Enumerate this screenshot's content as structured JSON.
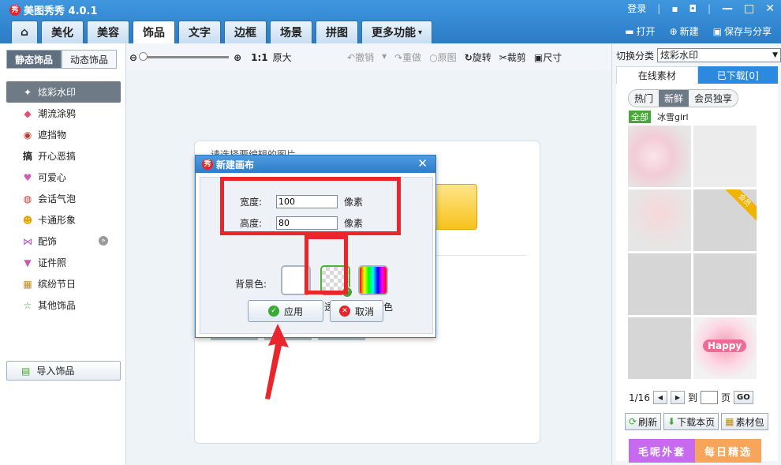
{
  "app": {
    "title": "美图秀秀 4.0.1",
    "logo_char": "秀"
  },
  "window": {
    "login": "登录",
    "sep": "|"
  },
  "main_tabs": [
    "美化",
    "美容",
    "饰品",
    "文字",
    "边框",
    "场景",
    "拼图",
    "更多功能"
  ],
  "right_actions": {
    "open": "打开",
    "new": "新建",
    "save_share": "保存与分享"
  },
  "toolbar": {
    "zoom_ratio": "1:1",
    "original_size": "原大",
    "undo": "撤销",
    "redo": "重做",
    "original": "原图",
    "rotate": "旋转",
    "crop": "裁剪",
    "size": "尺寸"
  },
  "left_panel": {
    "tabs": [
      "静态饰品",
      "动态饰品"
    ],
    "categories": [
      "炫彩水印",
      "潮流涂鸦",
      "遮挡物",
      "开心恶搞",
      "可爱心",
      "会话气泡",
      "卡通形象",
      "配饰",
      "证件照",
      "缤纷节日",
      "其他饰品"
    ],
    "import": "导入饰品"
  },
  "canvas": {
    "hint": "请选择要编辑的图片"
  },
  "dialog": {
    "title": "新建画布",
    "width_label": "宽度:",
    "width_value": "100",
    "height_label": "高度:",
    "height_value": "80",
    "unit": "像素",
    "bg_label": "背景色:",
    "swatch_white": "白色",
    "swatch_transparent": "透明",
    "swatch_custom": "自定颜色",
    "apply": "应用",
    "cancel": "取消",
    "selected_bg": "透明"
  },
  "right_panel": {
    "category_label": "切换分类",
    "category_value": "炫彩水印",
    "tabs": [
      "在线素材",
      "已下载[0]"
    ],
    "pills": [
      "热门",
      "新鲜",
      "会员独享"
    ],
    "filter_all": "全部",
    "filter_user": "冰雪girl",
    "vip": "会员",
    "happy": "Happy",
    "page": "1/16",
    "page_to": "到",
    "page_unit": "页",
    "go": "GO",
    "refresh": "刷新",
    "download_page": "下载本页",
    "pack": "素材包",
    "promo1": "毛呢外套",
    "promo2": "每日精选"
  },
  "colors": {
    "accent_blue": "#2b8ae0",
    "highlight_red": "#e8262c",
    "check_green": "#3aaa35"
  }
}
